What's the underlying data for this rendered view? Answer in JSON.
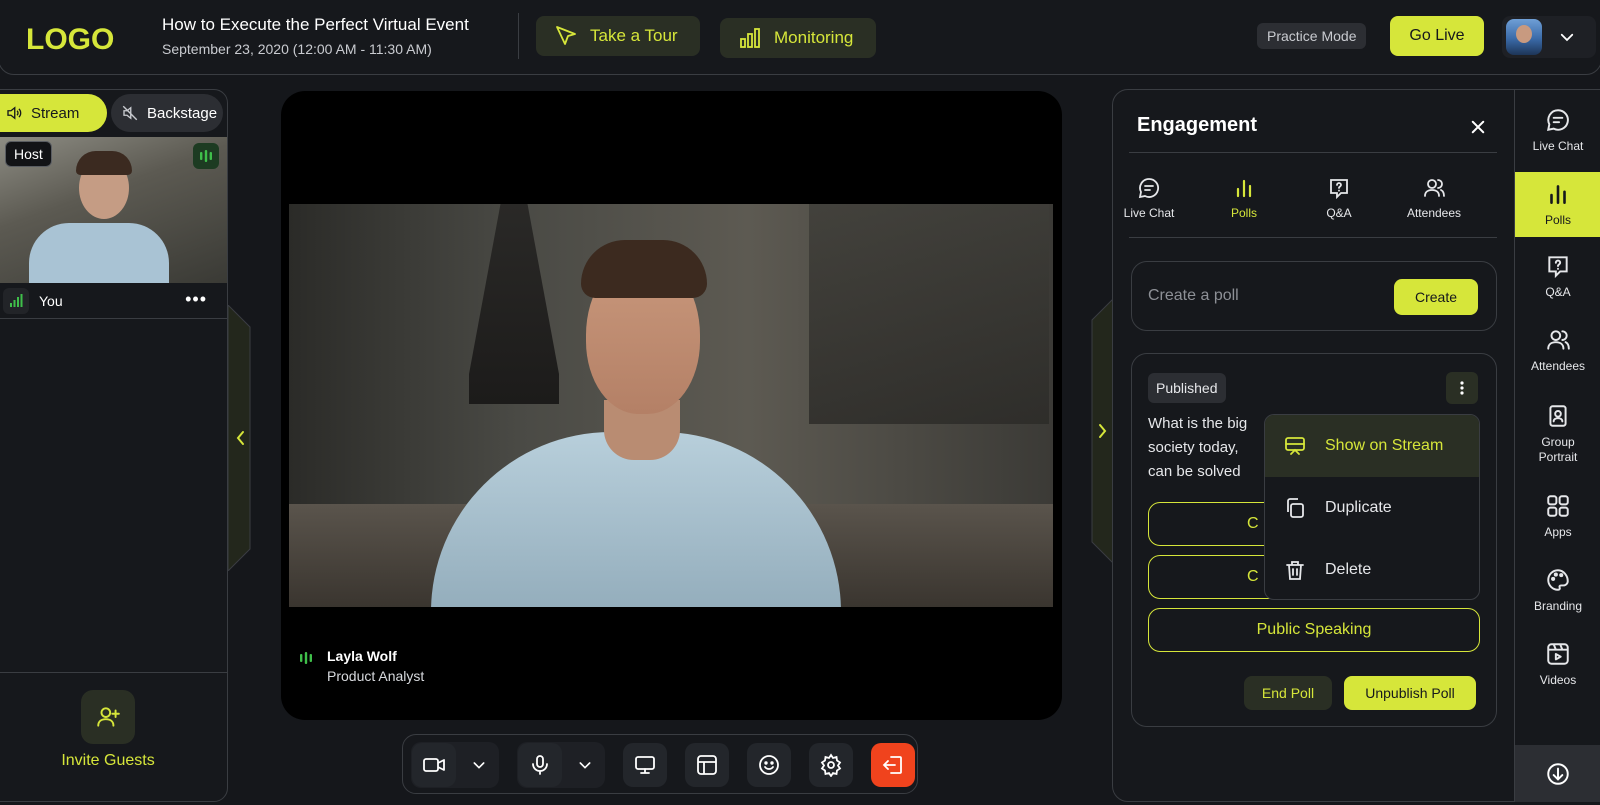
{
  "app": {
    "logo_text": "LOGO",
    "event_title": "How to Execute the Perfect Virtual Event",
    "event_date": "September 23, 2020 (12:00 AM - 11:30 AM)"
  },
  "header": {
    "tour_label": "Take a Tour",
    "monitoring_label": "Monitoring",
    "practice_label": "Practice Mode",
    "golive_label": "Go Live"
  },
  "left": {
    "stream_label": "Stream",
    "backstage_label": "Backstage",
    "host_badge": "Host",
    "you_label": "You",
    "more_label": "•••",
    "invite_label": "Invite Guests"
  },
  "stage": {
    "speaker_name": "Layla Wolf",
    "speaker_role": "Product Analyst"
  },
  "engagement": {
    "title": "Engagement",
    "tabs": [
      {
        "label": "Live Chat",
        "icon": "chat-icon"
      },
      {
        "label": "Polls",
        "icon": "bar-chart-icon",
        "active": true
      },
      {
        "label": "Q&A",
        "icon": "question-icon"
      },
      {
        "label": "Attendees",
        "icon": "people-icon"
      }
    ],
    "create_placeholder": "Create a poll",
    "create_label": "Create",
    "poll": {
      "status": "Published",
      "question_lines": [
        "What is the big",
        "society today,",
        "can be solved"
      ],
      "options": [
        "C",
        "C",
        "Public Speaking"
      ],
      "end_label": "End Poll",
      "unpublish_label": "Unpublish Poll"
    },
    "menu": [
      {
        "label": "Show on Stream",
        "icon": "cast-icon",
        "active": true
      },
      {
        "label": "Duplicate",
        "icon": "copy-icon"
      },
      {
        "label": "Delete",
        "icon": "trash-icon"
      }
    ]
  },
  "rail": {
    "items": [
      {
        "label": "Live Chat",
        "icon": "chat-icon"
      },
      {
        "label": "Polls",
        "icon": "bar-chart-icon",
        "active": true
      },
      {
        "label": "Q&A",
        "icon": "question-icon"
      },
      {
        "label": "Attendees",
        "icon": "people-icon"
      },
      {
        "label": "Group Portrait",
        "icon": "portrait-icon"
      },
      {
        "label": "Apps",
        "icon": "apps-icon"
      },
      {
        "label": "Branding",
        "icon": "palette-icon"
      },
      {
        "label": "Videos",
        "icon": "video-icon"
      }
    ]
  },
  "colors": {
    "accent": "#d6e63a",
    "background": "#16181c",
    "leave": "#f0431d",
    "mic_active": "#3fbf4a"
  }
}
